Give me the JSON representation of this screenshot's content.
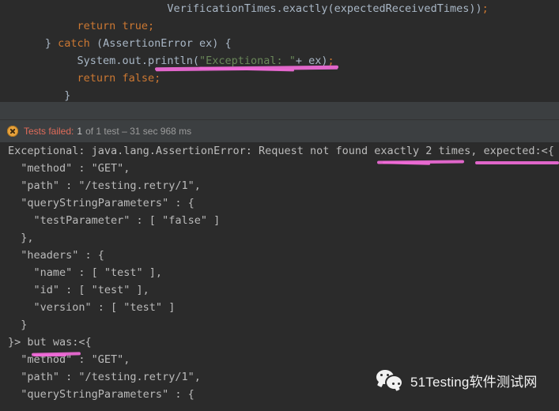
{
  "editor": {
    "lines": [
      {
        "indent": 26,
        "segments": [
          {
            "t": "VerificationTimes.exactly(expectedReceivedTimes))",
            "c": "plain"
          },
          {
            "t": ";",
            "c": "semi"
          }
        ]
      },
      {
        "indent": 12,
        "segments": [
          {
            "t": "return ",
            "c": "kw"
          },
          {
            "t": "true",
            "c": "kw"
          },
          {
            "t": ";",
            "c": "semi"
          }
        ]
      },
      {
        "indent": 7,
        "segments": [
          {
            "t": "} ",
            "c": "plain"
          },
          {
            "t": "catch",
            "c": "kw"
          },
          {
            "t": " (AssertionError ex) {",
            "c": "plain"
          }
        ]
      },
      {
        "indent": 12,
        "segments": [
          {
            "t": "System.out.println(",
            "c": "plain"
          },
          {
            "t": "\"Exceptional: \"",
            "c": "str"
          },
          {
            "t": "+ ex)",
            "c": "plain"
          },
          {
            "t": ";",
            "c": "semi"
          }
        ]
      },
      {
        "indent": 12,
        "segments": [
          {
            "t": "return ",
            "c": "kw"
          },
          {
            "t": "false",
            "c": "kw"
          },
          {
            "t": ";",
            "c": "semi"
          }
        ]
      },
      {
        "indent": 10,
        "segments": [
          {
            "t": "}",
            "c": "plain"
          }
        ]
      }
    ]
  },
  "status": {
    "icon": "test-failed-icon",
    "failed_label": "Tests failed:",
    "count": "1",
    "detail": "of 1 test – 31 sec 968 ms"
  },
  "console": {
    "lines": [
      "Exceptional: java.lang.AssertionError: Request not found exactly 2 times, expected:<{",
      "  \"method\" : \"GET\",",
      "  \"path\" : \"/testing.retry/1\",",
      "  \"queryStringParameters\" : {",
      "    \"testParameter\" : [ \"false\" ]",
      "  },",
      "  \"headers\" : {",
      "    \"name\" : [ \"test\" ],",
      "    \"id\" : [ \"test\" ],",
      "    \"version\" : [ \"test\" ]",
      "  }",
      "}> but was:<{",
      "  \"method\" : \"GET\",",
      "  \"path\" : \"/testing.retry/1\",",
      "  \"queryStringParameters\" : {"
    ]
  },
  "annotations": {
    "marks": [
      "println-statement-underline",
      "exactly-2-times-underline",
      "expected-underline",
      "but-was-underline"
    ]
  },
  "watermark": {
    "icon": "wechat-icon",
    "text": "51Testing软件测试网"
  },
  "colors": {
    "editor_bg": "#2b2b2b",
    "panel_bg": "#3c3f41",
    "keyword": "#cc7832",
    "string": "#6a8759",
    "plain": "#a9b7c6",
    "console_text": "#bbbbbb",
    "failed_text": "#e06c5a",
    "status_icon": "#e8a33d",
    "highlighter": "#f06bd8"
  }
}
